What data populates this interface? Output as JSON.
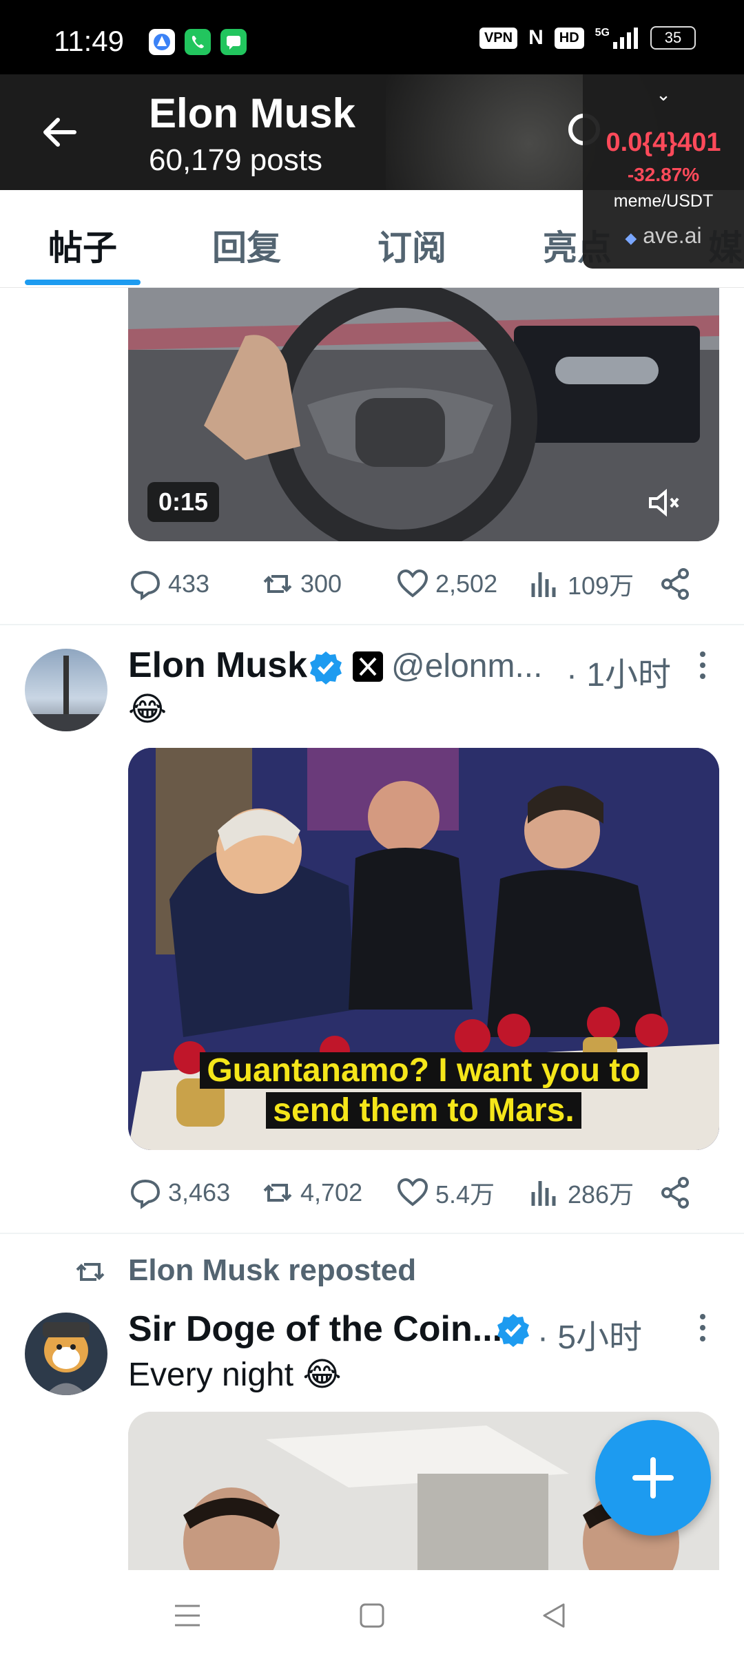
{
  "status_bar": {
    "time": "11:49",
    "indicators": [
      "VPN",
      "N",
      "HD",
      "5G"
    ],
    "battery": "35"
  },
  "header": {
    "title": "Elon Musk",
    "subtitle": "60,179 posts"
  },
  "ticker": {
    "price": "0.0{4}401",
    "change": "-32.87%",
    "pair": "meme/USDT",
    "site": "ave.ai",
    "color": "#ff4a5a"
  },
  "tabs": [
    {
      "label": "帖子",
      "active": true
    },
    {
      "label": "回复"
    },
    {
      "label": "订阅"
    },
    {
      "label": "亮点"
    },
    {
      "label": "媒"
    }
  ],
  "posts": [
    {
      "video_duration": "0:15",
      "actions": {
        "replies": "433",
        "reposts": "300",
        "likes": "2,502",
        "views": "109万"
      }
    },
    {
      "author": "Elon Musk",
      "handle": "@elonm...",
      "time": "· 1小时",
      "text": "😂",
      "image_caption_line1": "Guantanamo? I want you to",
      "image_caption_line2": "send them to Mars.",
      "actions": {
        "replies": "3,463",
        "reposts": "4,702",
        "likes": "5.4万",
        "views": "286万"
      }
    },
    {
      "repost_label": "Elon Musk reposted",
      "author": "Sir Doge of the Coin...",
      "time": "· 5小时",
      "text": "Every night 😂"
    }
  ],
  "colors": {
    "accent": "#1d9bf0",
    "secondary_text": "#536471"
  }
}
